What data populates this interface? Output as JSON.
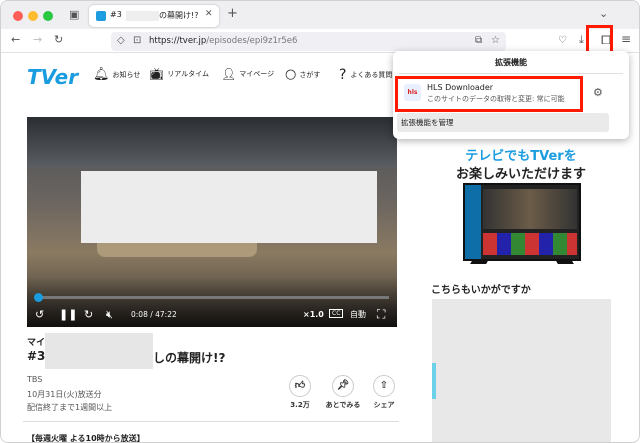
{
  "browser": {
    "tab_title": "#3",
    "tab_title_end": "の幕開け!?",
    "url_host": "https://tver.jp",
    "url_path": "/episodes/epi9z1r5e6"
  },
  "site": {
    "logo": "TVer",
    "nav": [
      {
        "icon": "bell-icon",
        "label": "お知らせ"
      },
      {
        "icon": "tv-icon",
        "label": "リアルタイム"
      },
      {
        "icon": "person-icon",
        "label": "マイページ"
      },
      {
        "icon": "search-icon",
        "label": "さがす"
      },
      {
        "icon": "question-icon",
        "label": "よくある質問"
      }
    ]
  },
  "player": {
    "time": "0:08 / 47:22",
    "speed": "×1.0",
    "cc": "CC",
    "auto": "自動",
    "progress": 0.003
  },
  "episode": {
    "series": "マイ",
    "title_start": "#3",
    "title_end": "しの幕開け!?",
    "broadcaster": "TBS",
    "airdate": "10月31日(火)放送分",
    "availability": "配信終了まで1週間以上",
    "like_count": "3.2万",
    "watch_later": "あとでみる",
    "share": "シェア",
    "schedule": "【毎週火曜 よる10時から放送】"
  },
  "promo": {
    "line1": "テレビでもTVerを",
    "line1_tverword": "TVer",
    "line2": "お楽しみいただけます"
  },
  "recommend": {
    "heading": "こちらもいかがですか"
  },
  "extensions_popup": {
    "title": "拡張機能",
    "name": "HLS Downloader",
    "desc": "このサイトのデータの取得と変更: 常に可能",
    "manage": "拡張機能を管理"
  }
}
